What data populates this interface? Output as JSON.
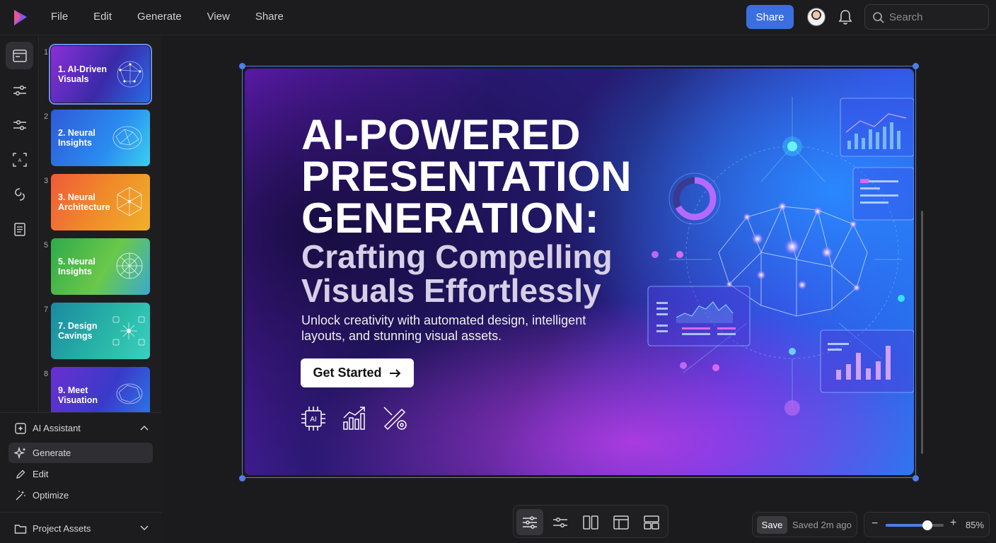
{
  "app": {
    "menu": [
      "File",
      "Edit",
      "Generate",
      "View",
      "Share"
    ],
    "share_label": "Share",
    "search_placeholder": "Search"
  },
  "slides": [
    {
      "num": "1",
      "label": "1. AI-Driven Visuals",
      "bg": "#6a2fd0"
    },
    {
      "num": "2",
      "label": "2. Neural Insights",
      "bg": "#2f74e8"
    },
    {
      "num": "3",
      "label": "3. Neural Architecture",
      "bg": "#f0762f"
    },
    {
      "num": "5",
      "label": "5. Neural Insights",
      "bg": "#3fae5a"
    },
    {
      "num": "7",
      "label": "7. Design Cavings",
      "bg": "#1f9aa0"
    },
    {
      "num": "8",
      "label": "9. Meet Visuation",
      "bg": "#5a2fc8"
    }
  ],
  "ai_panel": {
    "title": "AI Assistant",
    "items": [
      "Generate",
      "Edit",
      "Optimize"
    ],
    "project_assets": "Project Assets"
  },
  "slide": {
    "title": "AI-POWERED PRESENTATION GENERATION:",
    "subtitle": "Crafting Compelling Visuals Effortlessly",
    "body": "Unlock creativity with automated design, intelligent layouts, and stunning visual assets.",
    "cta": "Get Started",
    "feature_icons": [
      "ai-chip-icon",
      "growth-chart-icon",
      "design-tools-icon"
    ]
  },
  "footer": {
    "save_label": "Save",
    "saved_status": "Saved 2m ago",
    "zoom": "85%",
    "zoom_fraction": 0.72
  },
  "colors": {
    "accent": "#3b6fe0",
    "selection": "#4d7fe8"
  }
}
